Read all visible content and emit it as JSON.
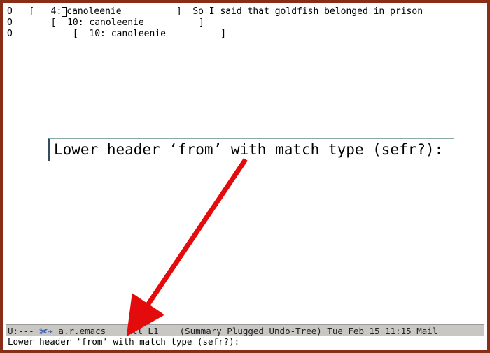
{
  "summary": {
    "rows": [
      {
        "mark": "O",
        "indent": 0,
        "count": "4",
        "author": "canoleenie",
        "subject": "So I said that goldfish belonged in prison",
        "has_cursor": true
      },
      {
        "mark": "O",
        "indent": 1,
        "count": "10",
        "author": "canoleenie",
        "subject": "",
        "has_cursor": false
      },
      {
        "mark": "O",
        "indent": 2,
        "count": "10",
        "author": "canoleenie",
        "subject": "",
        "has_cursor": false
      }
    ]
  },
  "callout": {
    "text": "Lower header ‘from’ with match type (sefr?):"
  },
  "modeline": {
    "left": "U:--- ",
    "icon": "✀✈",
    "buffer": " a.r.emacs ",
    "pos": "   All L1   ",
    "modes": " (Summary Plugged Undo-Tree) ",
    "date": "Tue Feb 15 11:15 ",
    "tail": "Mail "
  },
  "minibuffer": {
    "prompt": "Lower header 'from' with match type (sefr?): "
  }
}
